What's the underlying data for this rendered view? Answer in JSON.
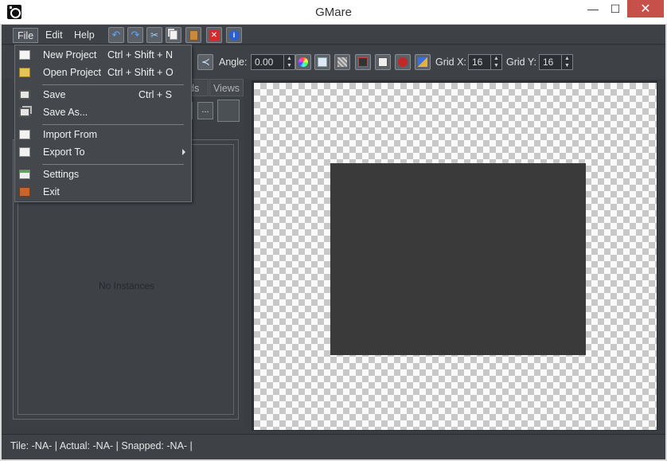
{
  "window": {
    "title": "GMare",
    "minimize": "—",
    "maximize": "☐",
    "close": "✕"
  },
  "menubar": {
    "file": "File",
    "edit": "Edit",
    "help": "Help"
  },
  "toolbar2": {
    "angle_label": "Angle:",
    "angle_value": "0.00",
    "grid_x_label": "Grid X:",
    "grid_x_value": "16",
    "grid_y_label": "Grid Y:",
    "grid_y_value": "16"
  },
  "left_panel": {
    "tab_backgrounds_partial": "ds",
    "tab_views": "Views",
    "browse_button": "...",
    "no_instances": "No Instances"
  },
  "status": {
    "text": "Tile: -NA- | Actual: -NA- | Snapped: -NA- |"
  },
  "file_menu": {
    "items": [
      {
        "label": "New Project",
        "shortcut": "Ctrl + Shift + N"
      },
      {
        "label": "Open Project",
        "shortcut": "Ctrl + Shift + O"
      },
      {
        "label": "Save",
        "shortcut": "Ctrl + S"
      },
      {
        "label": "Save As...",
        "shortcut": ""
      },
      {
        "label": "Import From",
        "shortcut": ""
      },
      {
        "label": "Export To",
        "shortcut": ""
      },
      {
        "label": "Settings",
        "shortcut": ""
      },
      {
        "label": "Exit",
        "shortcut": ""
      }
    ]
  },
  "colors": {
    "app_bg": "#3a3d42",
    "close_button": "#c7504b",
    "room_fill": "#3a3a3a"
  }
}
